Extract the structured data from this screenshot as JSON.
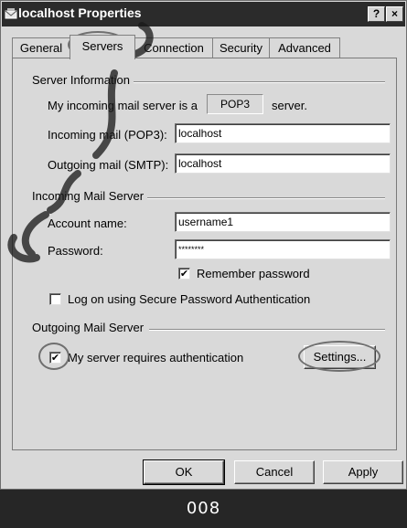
{
  "window": {
    "title": "localhost Properties",
    "help_label": "?",
    "close_label": "×"
  },
  "tabs": [
    {
      "label": "General"
    },
    {
      "label": "Servers"
    },
    {
      "label": "Connection"
    },
    {
      "label": "Security"
    },
    {
      "label": "Advanced"
    }
  ],
  "server_info": {
    "heading": "Server Information",
    "incoming_prefix": "My incoming mail server is a",
    "server_type": "POP3",
    "incoming_suffix": "server.",
    "incoming_label": "Incoming mail (POP3):",
    "incoming_value": "localhost",
    "outgoing_label": "Outgoing mail (SMTP):",
    "outgoing_value": "localhost"
  },
  "incoming_server": {
    "heading": "Incoming Mail Server",
    "account_label": "Account name:",
    "account_value": "username1",
    "password_label": "Password:",
    "password_value": "********",
    "remember_label": "Remember password",
    "remember_checked": "✔",
    "spa_label": "Log on using Secure Password Authentication"
  },
  "outgoing_server": {
    "heading": "Outgoing Mail Server",
    "auth_label": "My server requires authentication",
    "auth_checked": "✔",
    "settings_label": "Settings..."
  },
  "footer": {
    "ok_label": "OK",
    "cancel_label": "Cancel",
    "apply_label": "Apply"
  },
  "caption": {
    "text": "008"
  },
  "icons": {
    "app": "mail-properties-icon"
  },
  "colors": {
    "titlebar": "#2b2b2b",
    "dialog": "#d9d9d9",
    "caption_bar": "#262626",
    "annotation": "#6f6f6f"
  }
}
